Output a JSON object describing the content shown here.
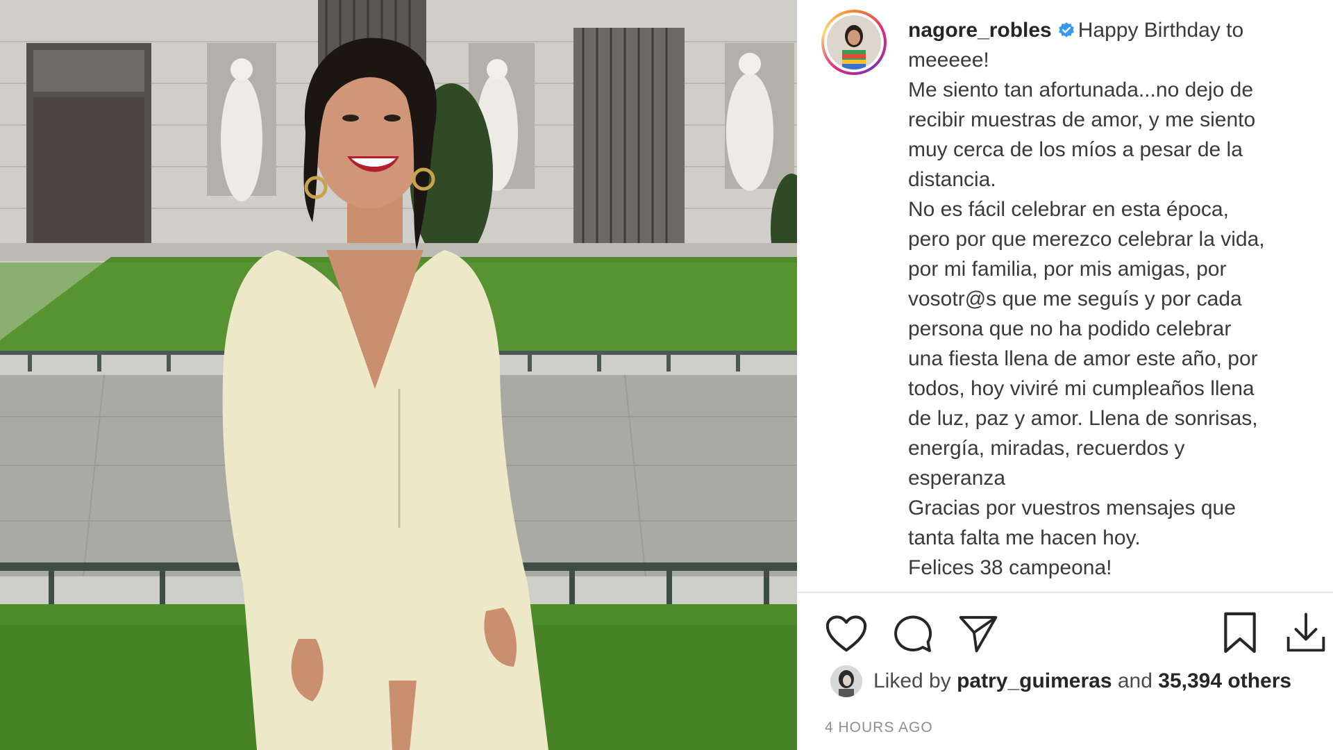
{
  "post": {
    "username": "nagore_robles",
    "caption_lines": [
      "Happy Birthday to",
      "meeeee!",
      "Me siento tan afortunada...no dejo de",
      "recibir muestras de amor, y me siento",
      "muy cerca de los míos a pesar de la",
      "distancia.",
      "No es fácil celebrar en esta época,",
      "pero por que merezco celebrar la vida,",
      "por mi familia, por mis amigas, por",
      "vosotr@s que me seguís y por cada",
      "persona que no ha podido celebrar",
      "una fiesta llena de amor este año, por",
      "todos, hoy viviré mi cumpleaños llena",
      "de luz, paz y amor. Llena de sonrisas,",
      "energía, miradas, recuerdos y",
      "esperanza",
      "Gracias por vuestros mensajes que",
      "tanta falta me hacen hoy.",
      "Felices 38 campeona!"
    ],
    "likes": {
      "prefix": "Liked by",
      "user": "patry_guimeras",
      "middle": "and",
      "count": "35,394 others"
    },
    "timestamp": "4 HOURS AGO"
  },
  "icons": {
    "like": "heart-icon",
    "comment": "comment-icon",
    "share": "paper-plane-icon",
    "save": "bookmark-icon",
    "download": "download-icon",
    "verified": "verified-badge-icon"
  },
  "colors": {
    "verified_blue": "#3897f0",
    "text": "#3a3a3a",
    "username": "#262626",
    "timestamp": "#8e8e8e"
  }
}
